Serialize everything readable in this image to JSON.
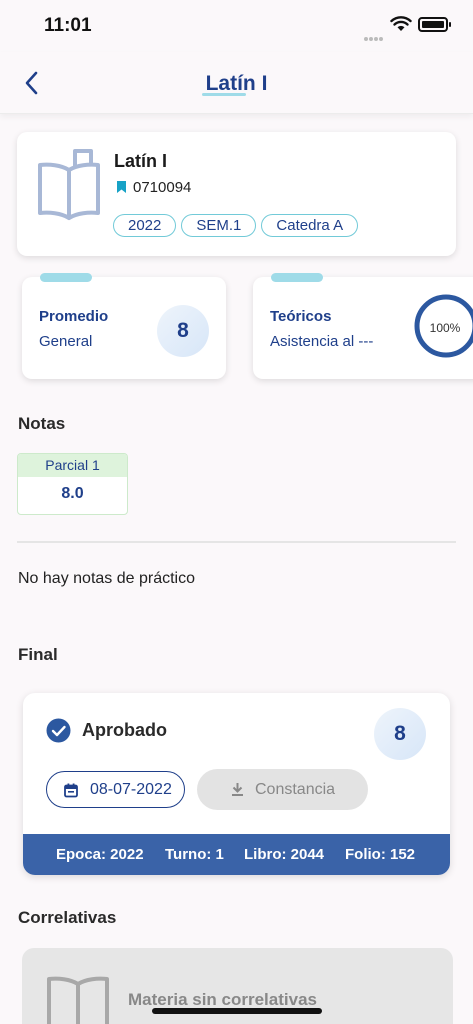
{
  "status_bar": {
    "time": "11:01"
  },
  "nav": {
    "title": "Latín I"
  },
  "subject": {
    "name": "Latín I",
    "code": "0710094",
    "chips": [
      "2022",
      "SEM.1",
      "Catedra A"
    ]
  },
  "promedio": {
    "label": "Promedio",
    "sub": "General",
    "value": "8"
  },
  "teoricos": {
    "label": "Teóricos",
    "sub": "Asistencia al ---",
    "percent_text": "100%",
    "percent_value": 100
  },
  "notas": {
    "title": "Notas",
    "grades": [
      {
        "label": "Parcial 1",
        "value": "8.0"
      }
    ],
    "no_practico": "No hay notas de práctico"
  },
  "final": {
    "title": "Final",
    "status": "Aprobado",
    "grade": "8",
    "date": "08-07-2022",
    "constancia_label": "Constancia",
    "epoca": "Epoca: 2022",
    "turno": "Turno: 1",
    "libro": "Libro: 2044",
    "folio": "Folio: 152"
  },
  "correlativas": {
    "title": "Correlativas",
    "empty_text": "Materia sin correlativas"
  },
  "colors": {
    "primary": "#1f3f8a",
    "accent": "#9fdbe8",
    "bar": "#3a63a8",
    "grade_head": "#def3dc"
  },
  "icons": [
    "back-arrow-icon",
    "book-icon",
    "bookmark-icon",
    "check-circle-icon",
    "calendar-icon",
    "download-icon",
    "wifi-icon",
    "battery-icon"
  ]
}
